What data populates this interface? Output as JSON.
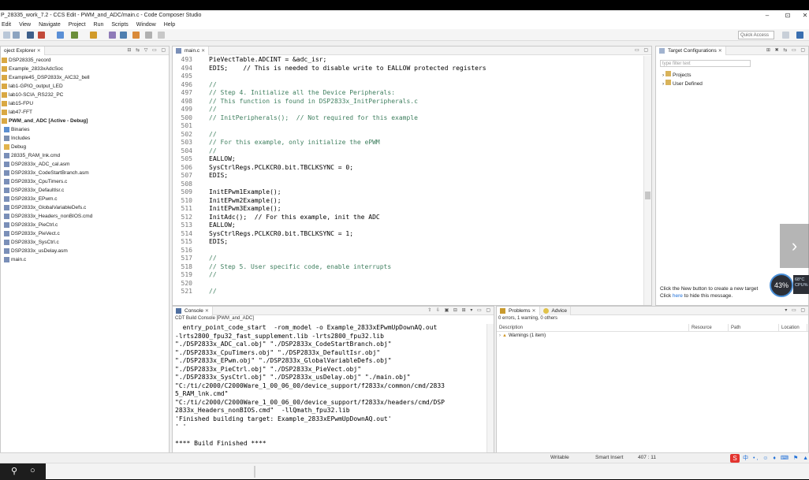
{
  "window": {
    "title": "P_28335_work_7.2 - CCS Edit - PWM_and_ADC/main.c - Code Composer Studio",
    "controls": [
      "–",
      "⊡",
      "✕"
    ]
  },
  "menu": [
    "Edit",
    "View",
    "Navigate",
    "Project",
    "Run",
    "Scripts",
    "Window",
    "Help"
  ],
  "toolbar": {
    "quick_access_placeholder": "Quick Access"
  },
  "project_explorer": {
    "title": "oject Explorer",
    "items": [
      {
        "label": "DSP28335_record",
        "icon": "project"
      },
      {
        "label": "Example_2833xAdcSoc",
        "icon": "project"
      },
      {
        "label": "Example45_DSP2833x_AIC32_bell",
        "icon": "project"
      },
      {
        "label": "lab1-GPIO_output_LED",
        "icon": "project"
      },
      {
        "label": "lab10-SCIA_RS232_PC",
        "icon": "project"
      },
      {
        "label": "lab15-FPU",
        "icon": "project"
      },
      {
        "label": "lab47-FFT",
        "icon": "project"
      },
      {
        "label": "PWM_and_ADC  [Active - Debug]",
        "icon": "project",
        "active": true
      },
      {
        "label": "Binaries",
        "icon": "binaries",
        "indent": 1
      },
      {
        "label": "Includes",
        "icon": "includes",
        "indent": 1
      },
      {
        "label": "Debug",
        "icon": "folder",
        "indent": 1
      },
      {
        "label": "28335_RAM_lnk.cmd",
        "icon": "file",
        "indent": 1
      },
      {
        "label": "DSP2833x_ADC_cal.asm",
        "icon": "file",
        "indent": 1
      },
      {
        "label": "DSP2833x_CodeStartBranch.asm",
        "icon": "file",
        "indent": 1
      },
      {
        "label": "DSP2833x_CpuTimers.c",
        "icon": "file",
        "indent": 1
      },
      {
        "label": "DSP2833x_DefaultIsr.c",
        "icon": "file",
        "indent": 1
      },
      {
        "label": "DSP2833x_EPwm.c",
        "icon": "file",
        "indent": 1
      },
      {
        "label": "DSP2833x_GlobalVariableDefs.c",
        "icon": "file",
        "indent": 1
      },
      {
        "label": "DSP2833x_Headers_nonBIOS.cmd",
        "icon": "file",
        "indent": 1
      },
      {
        "label": "DSP2833x_PieCtrl.c",
        "icon": "file",
        "indent": 1
      },
      {
        "label": "DSP2833x_PieVect.c",
        "icon": "file",
        "indent": 1
      },
      {
        "label": "DSP2833x_SysCtrl.c",
        "icon": "file",
        "indent": 1
      },
      {
        "label": "DSP2833x_usDelay.asm",
        "icon": "file",
        "indent": 1
      },
      {
        "label": "main.c",
        "icon": "file",
        "indent": 1
      }
    ]
  },
  "editor": {
    "tab": "main.c",
    "lines": [
      {
        "n": "493",
        "t": "PieVectTable.ADCINT = &adc_isr;"
      },
      {
        "n": "494",
        "t": "EDIS;    // This is needed to disable write to EALLOW protected registers"
      },
      {
        "n": "495",
        "t": ""
      },
      {
        "n": "496",
        "t": "//"
      },
      {
        "n": "497",
        "t": "// Step 4. Initialize all the Device Peripherals:"
      },
      {
        "n": "498",
        "t": "// This function is found in DSP2833x_InitPeripherals.c"
      },
      {
        "n": "499",
        "t": "//"
      },
      {
        "n": "500",
        "t": "// InitPeripherals();  // Not required for this example"
      },
      {
        "n": "501",
        "t": ""
      },
      {
        "n": "502",
        "t": "//"
      },
      {
        "n": "503",
        "t": "// For this example, only initialize the ePWM"
      },
      {
        "n": "504",
        "t": "//"
      },
      {
        "n": "505",
        "t": "EALLOW;"
      },
      {
        "n": "506",
        "t": "SysCtrlRegs.PCLKCR0.bit.TBCLKSYNC = 0;"
      },
      {
        "n": "507",
        "t": "EDIS;"
      },
      {
        "n": "508",
        "t": ""
      },
      {
        "n": "509",
        "t": "InitEPwm1Example();"
      },
      {
        "n": "510",
        "t": "InitEPwm2Example();"
      },
      {
        "n": "511",
        "t": "InitEPwm3Example();"
      },
      {
        "n": "512",
        "t": "InitAdc();  // For this example, init the ADC"
      },
      {
        "n": "513",
        "t": "EALLOW;"
      },
      {
        "n": "514",
        "t": "SysCtrlRegs.PCLKCR0.bit.TBCLKSYNC = 1;"
      },
      {
        "n": "515",
        "t": "EDIS;"
      },
      {
        "n": "516",
        "t": ""
      },
      {
        "n": "517",
        "t": "//"
      },
      {
        "n": "518",
        "t": "// Step 5. User specific code, enable interrupts"
      },
      {
        "n": "519",
        "t": "//"
      },
      {
        "n": "520",
        "t": ""
      },
      {
        "n": "521",
        "t": "//"
      }
    ]
  },
  "target_config": {
    "title": "Target Configurations",
    "filter_placeholder": "type filter text",
    "items": [
      "Projects",
      "User Defined"
    ],
    "hint_line1": "Click the New button to create a new target",
    "hint_line2_pre": "Click ",
    "hint_link": "here",
    "hint_line2_post": " to hide this message."
  },
  "console": {
    "tab": "Console",
    "subtitle": "CDT Build Console [PWM_and_ADC]",
    "lines": [
      "  entry_point_code_start  -rom_model -o Example_2833xEPwmUpDownAQ.out",
      "-lrts2800_fpu32_fast_supplement.lib -lrts2800_fpu32.lib",
      "\"./DSP2833x_ADC_cal.obj\" \"./DSP2833x_CodeStartBranch.obj\"",
      "\"./DSP2833x_CpuTimers.obj\" \"./DSP2833x_DefaultIsr.obj\"",
      "\"./DSP2833x_EPwm.obj\" \"./DSP2833x_GlobalVariableDefs.obj\"",
      "\"./DSP2833x_PieCtrl.obj\" \"./DSP2833x_PieVect.obj\"",
      "\"./DSP2833x_SysCtrl.obj\" \"./DSP2833x_usDelay.obj\" \"./main.obj\"",
      "\"C:/ti/c2000/C2000Ware_1_00_06_00/device_support/f2833x/common/cmd/2833",
      "5_RAM_lnk.cmd\"",
      "\"C:/ti/c2000/C2000Ware_1_00_06_00/device_support/f2833x/headers/cmd/DSP",
      "2833x_Headers_nonBIOS.cmd\"  -llQmath_fpu32.lib",
      "'Finished building target: Example_2833xEPwmUpDownAQ.out'",
      "' '",
      "",
      "**** Build Finished ****"
    ]
  },
  "problems": {
    "tab1": "Problems",
    "tab2": "Advice",
    "summary": "0 errors, 1 warning, 0 others",
    "columns": [
      "Description",
      "Resource",
      "Path",
      "Location"
    ],
    "rows": [
      {
        "label": "Warnings (1 item)"
      }
    ]
  },
  "statusbar": {
    "writable": "Writable",
    "insert_mode": "Smart Insert",
    "position": "407 : 11"
  },
  "overlay": {
    "cpu_percent": "43%",
    "cpu_temp": "68°C",
    "cpu_label": "CPU%"
  },
  "colors": {
    "comment": "#3f7f5f",
    "member": "#0000c0",
    "keyword": "#7f0055",
    "active_project": "#000000",
    "accent": "#1e6fd9"
  }
}
